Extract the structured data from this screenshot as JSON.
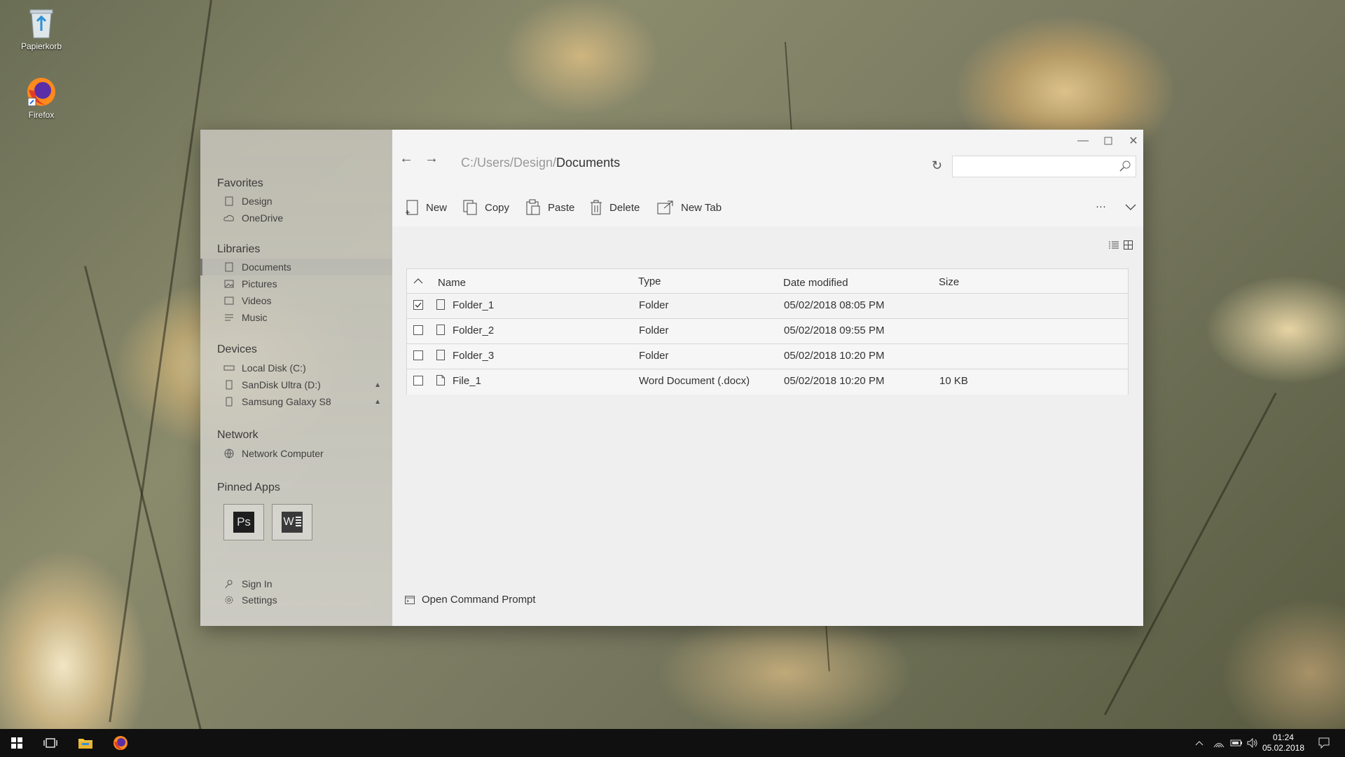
{
  "desktop": {
    "icons": [
      {
        "label": "Papierkorb",
        "icon": "recycle-bin-icon"
      },
      {
        "label": "Firefox",
        "icon": "firefox-icon"
      }
    ]
  },
  "window": {
    "path_prefix": "C:/Users/Design/",
    "path_current": "Documents",
    "search_placeholder": "",
    "toolbar": {
      "new": "New",
      "copy": "Copy",
      "paste": "Paste",
      "delete": "Delete",
      "new_tab": "New Tab",
      "more": "···"
    },
    "footer": {
      "open_cmd": "Open Command Prompt"
    }
  },
  "sidebar": {
    "favorites_title": "Favorites",
    "favorites": [
      {
        "label": "Design",
        "icon": "bookmark-icon"
      },
      {
        "label": "OneDrive",
        "icon": "cloud-icon"
      }
    ],
    "libraries_title": "Libraries",
    "libraries": [
      {
        "label": "Documents",
        "icon": "document-icon",
        "active": true
      },
      {
        "label": "Pictures",
        "icon": "picture-icon"
      },
      {
        "label": "Videos",
        "icon": "video-icon"
      },
      {
        "label": "Music",
        "icon": "music-icon"
      }
    ],
    "devices_title": "Devices",
    "devices": [
      {
        "label": "Local Disk (C:)",
        "icon": "drive-icon"
      },
      {
        "label": "SanDisk Ultra (D:)",
        "icon": "usb-icon",
        "eject": "▲"
      },
      {
        "label": "Samsung Galaxy S8",
        "icon": "phone-icon",
        "eject": "▲"
      }
    ],
    "network_title": "Network",
    "network": [
      {
        "label": "Network Computer",
        "icon": "globe-icon"
      }
    ],
    "pinned_title": "Pinned Apps",
    "pinned": [
      {
        "label": "Ps",
        "icon": "photoshop-icon"
      },
      {
        "label": "W",
        "icon": "word-icon"
      }
    ],
    "sign_in": "Sign In",
    "settings": "Settings"
  },
  "table": {
    "columns": {
      "name": "Name",
      "type": "Type",
      "date": "Date modified",
      "size": "Size"
    },
    "rows": [
      {
        "name": "Folder_1",
        "type": "Folder",
        "date": "05/02/2018 08:05 PM",
        "size": "",
        "checked": true
      },
      {
        "name": "Folder_2",
        "type": "Folder",
        "date": "05/02/2018 09:55 PM",
        "size": "",
        "checked": false
      },
      {
        "name": "Folder_3",
        "type": "Folder",
        "date": "05/02/2018 10:20 PM",
        "size": "",
        "checked": false
      },
      {
        "name": "File_1",
        "type": "Word Document (.docx)",
        "date": "05/02/2018 10:20 PM",
        "size": "10 KB",
        "checked": false
      }
    ]
  },
  "taskbar": {
    "time": "01:24",
    "date": "05.02.2018"
  },
  "colors": {
    "taskbar": "#101010",
    "accent": "#0078d7"
  }
}
